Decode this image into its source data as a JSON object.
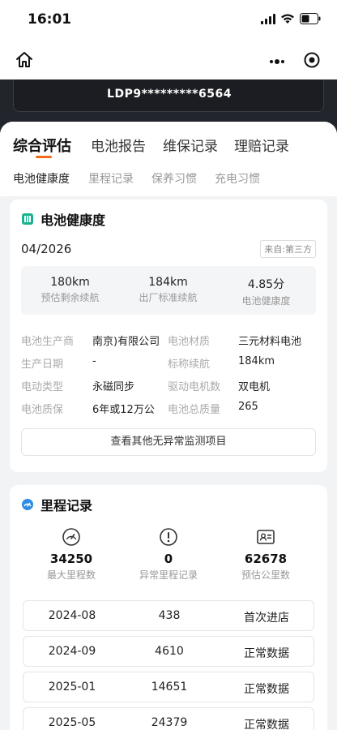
{
  "status_bar": {
    "time": "16:01"
  },
  "vehicle": {
    "plate": "LDP9*********6564"
  },
  "tabs": [
    {
      "label": "综合评估"
    },
    {
      "label": "电池报告"
    },
    {
      "label": "维保记录"
    },
    {
      "label": "理赔记录"
    }
  ],
  "subtabs": [
    {
      "label": "电池健康度"
    },
    {
      "label": "里程记录"
    },
    {
      "label": "保养习惯"
    },
    {
      "label": "充电习惯"
    }
  ],
  "battery_health": {
    "title": "电池健康度",
    "date": "04/2026",
    "source": "来自:第三方",
    "metrics": [
      {
        "value": "180km",
        "label": "预估剩余续航"
      },
      {
        "value": "184km",
        "label": "出厂标准续航"
      },
      {
        "value": "4.85分",
        "label": "电池健康度"
      }
    ],
    "info": [
      {
        "label1": "电池生产商",
        "value1": "南京)有限公司",
        "label2": "电池材质",
        "value2": "三元材料电池"
      },
      {
        "label1": "生产日期",
        "value1": "-",
        "label2": "标称续航",
        "value2": "184km"
      },
      {
        "label1": "电动类型",
        "value1": "永磁同步",
        "label2": "驱动电机数",
        "value2": "双电机"
      },
      {
        "label1": "电池质保",
        "value1": "6年或12万公",
        "label2": "电池总质量",
        "value2": "265"
      }
    ],
    "check_button": "查看其他无异常监测项目"
  },
  "mileage": {
    "title": "里程记录",
    "stats": [
      {
        "value": "34250",
        "label": "最大里程数",
        "icon": "gauge-icon"
      },
      {
        "value": "0",
        "label": "异常里程记录",
        "icon": "alert-icon"
      },
      {
        "value": "62678",
        "label": "预估公里数",
        "icon": "id-card-icon"
      }
    ],
    "records": [
      {
        "date": "2024-08",
        "km": "438",
        "status": "首次进店"
      },
      {
        "date": "2024-09",
        "km": "4610",
        "status": "正常数据"
      },
      {
        "date": "2025-01",
        "km": "14651",
        "status": "正常数据"
      },
      {
        "date": "2025-05",
        "km": "24379",
        "status": "正常数据"
      }
    ]
  },
  "colors": {
    "accent": "#f26b1d",
    "section_icon_green": "#19b28d",
    "section_icon_blue": "#2f8de4"
  }
}
